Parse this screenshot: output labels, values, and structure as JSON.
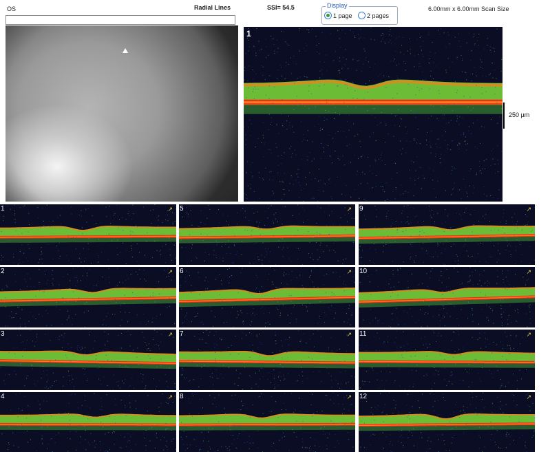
{
  "header": {
    "eye": "OS",
    "protocol": "Radial Lines",
    "ssi": "SSI= 54.5",
    "scan_size": "6.00mm x 6.00mm Scan Size"
  },
  "display": {
    "legend": "Display",
    "option_1": "1 page",
    "option_2": "2 pages",
    "selected": "1 page"
  },
  "main_scan": {
    "label": "1"
  },
  "scale": {
    "label": "250 µm"
  },
  "thumbnails": {
    "s1": "1",
    "s2": "2",
    "s3": "3",
    "s4": "4",
    "s5": "5",
    "s6": "6",
    "s7": "7",
    "s8": "8",
    "s9": "9",
    "s10": "10",
    "s11": "11",
    "s12": "12"
  },
  "colors": {
    "background": "#0b0d24",
    "retina_green": "#7fdc3a",
    "rpe_orange": "#ff7a1a",
    "rpe_red": "#e8321a"
  }
}
